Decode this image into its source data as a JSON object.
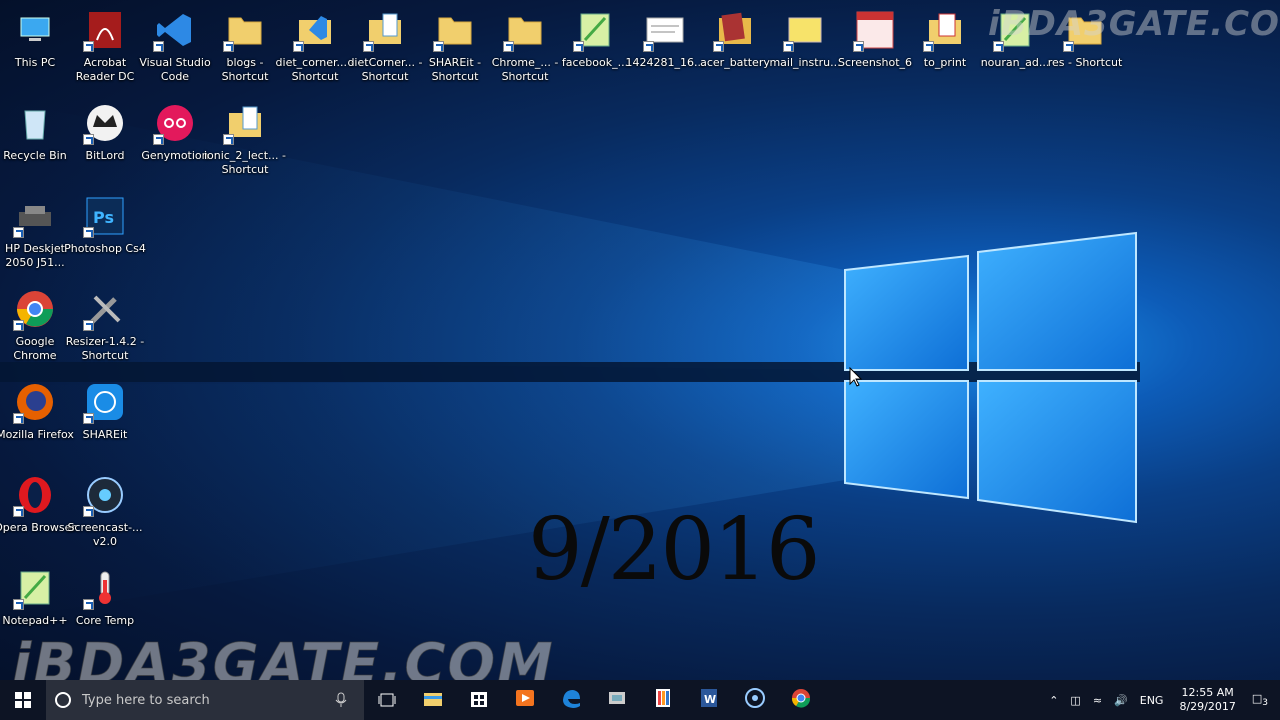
{
  "desktop": {
    "icons": [
      {
        "label": "This PC",
        "glyph": "pc-icon"
      },
      {
        "label": "Acrobat Reader DC",
        "glyph": "acrobat-icon"
      },
      {
        "label": "Visual Studio Code",
        "glyph": "vscode-icon"
      },
      {
        "label": "blogs - Shortcut",
        "glyph": "folder-icon"
      },
      {
        "label": "diet_corner... - Shortcut",
        "glyph": "vs-folder-icon"
      },
      {
        "label": "dietCorner... - Shortcut",
        "glyph": "folder-doc-icon"
      },
      {
        "label": "SHAREit - Shortcut",
        "glyph": "folder-icon"
      },
      {
        "label": "Chrome_... - Shortcut",
        "glyph": "folder-icon"
      },
      {
        "label": "facebook_...",
        "glyph": "notepadpp-icon"
      },
      {
        "label": "1424281_16...",
        "glyph": "image-doc-icon"
      },
      {
        "label": "acer_battery",
        "glyph": "folder-img-icon"
      },
      {
        "label": "mail_instru...",
        "glyph": "sticky-note-icon"
      },
      {
        "label": "Screenshot_6",
        "glyph": "screenshot-icon"
      },
      {
        "label": "to_print",
        "glyph": "pdf-folder-icon"
      },
      {
        "label": "nouran_ad...",
        "glyph": "notepadpp-icon"
      },
      {
        "label": "res - Shortcut",
        "glyph": "folder-icon"
      },
      {
        "label": "Recycle Bin",
        "glyph": "recycle-bin-icon"
      },
      {
        "label": "BitLord",
        "glyph": "bitlord-icon"
      },
      {
        "label": "Genymotion",
        "glyph": "genymotion-icon"
      },
      {
        "label": "ionic_2_lect... - Shortcut",
        "glyph": "folder-doc-icon"
      },
      {
        "label": "HP Deskjet 2050 J51...",
        "glyph": "printer-icon"
      },
      {
        "label": "Photoshop Cs4",
        "glyph": "photoshop-icon"
      },
      {
        "label": "Google Chrome",
        "glyph": "chrome-icon"
      },
      {
        "label": "Resizer-1.4.2 - Shortcut",
        "glyph": "tools-icon"
      },
      {
        "label": "Mozilla Firefox",
        "glyph": "firefox-icon"
      },
      {
        "label": "SHAREit",
        "glyph": "shareit-icon"
      },
      {
        "label": "Opera Browser",
        "glyph": "opera-icon"
      },
      {
        "label": "Screencast-... v2.0",
        "glyph": "screencast-icon"
      },
      {
        "label": "Notepad++",
        "glyph": "notepadpp-icon"
      },
      {
        "label": "Core Temp",
        "glyph": "thermometer-icon"
      }
    ],
    "overlay_year": "9/2016",
    "watermark": "iBDA3GATE.COM"
  },
  "taskbar": {
    "search_placeholder": "Type here to search",
    "apps": [
      "file-explorer-icon",
      "store-icon",
      "media-player-icon",
      "edge-icon",
      "folder-network-icon",
      "paint-app-icon",
      "word-icon",
      "screencast-app-icon",
      "chrome-icon"
    ],
    "tray": {
      "language": "ENG",
      "time": "12:55 AM",
      "date": "8/29/2017",
      "notification_count": "3"
    }
  },
  "colors": {
    "taskbar": "#0d1424",
    "search_box": "#2a2f3b",
    "logo_light": "#8fd3ff"
  }
}
